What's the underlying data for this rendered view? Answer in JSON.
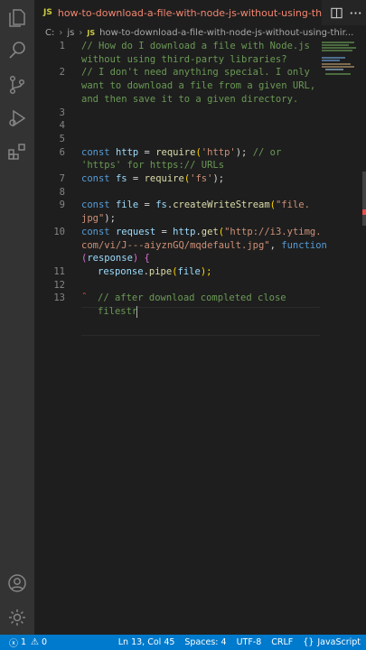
{
  "tab": {
    "language_badge": "JS",
    "title": "how-to-download-a-file-with-node-js-without-using-third-party-l"
  },
  "breadcrumb": {
    "drive": "C:",
    "folder": "js",
    "language_badge": "JS",
    "file": "how-to-download-a-file-with-node-js-without-using-thir..."
  },
  "editor": {
    "line_numbers": [
      "1",
      "2",
      "3",
      "4",
      "5",
      "6",
      "7",
      "8",
      "9",
      "10",
      "11",
      "12",
      "13"
    ],
    "code": {
      "l1a": "// How do I download a file with Node.js",
      "l1b": "without using third-party libraries?",
      "l2a": "// I don't need anything special. I only",
      "l2b": "want to download a file from a given URL,",
      "l2c": "and then save it to a given directory.",
      "l6_const": "const",
      "l6_http": "http",
      "l6_eq": " = ",
      "l6_require": "require",
      "l6_open": "(",
      "l6_str": "'http'",
      "l6_close": ");",
      "l6_comment": " // or",
      "l6_comment2": "'https' for https:// URLs",
      "l7_const": "const",
      "l7_fs": "fs",
      "l7_eq": " = ",
      "l7_require": "require",
      "l7_open": "(",
      "l7_str": "'fs'",
      "l7_close": ");",
      "l9_const": "const",
      "l9_file": "file",
      "l9_eq": " = ",
      "l9_fs": "fs",
      "l9_dot": ".",
      "l9_fn": "createWriteStream",
      "l9_open": "(",
      "l9_str1": "\"file.",
      "l9_str2": "jpg\"",
      "l9_close": ");",
      "l10_const": "const",
      "l10_request": "request",
      "l10_eq": " = ",
      "l10_http": "http",
      "l10_dot": ".",
      "l10_get": "get",
      "l10_open": "(",
      "l10_str1": "\"http://i3.ytimg.",
      "l10_str2": "com/vi/J---aiyznGQ/mqdefault.jpg\"",
      "l10_comma": ", ",
      "l10_function": "function",
      "l10_popen": "(",
      "l10_response": "response",
      "l10_pclose": ")",
      "l10_brace": " {",
      "l11_response": "response",
      "l11_dot": ".",
      "l11_pipe": "pipe",
      "l11_open": "(",
      "l11_file": "file",
      "l11_close": ");",
      "l13a": "// after download completed close",
      "l13b": "filestr"
    }
  },
  "statusbar": {
    "errors": "1",
    "warnings": "0",
    "position": "Ln 13, Col 45",
    "spaces": "Spaces: 4",
    "encoding": "UTF-8",
    "eol": "CRLF",
    "language": "JavaScript"
  },
  "colors": {
    "accent": "#007acc",
    "tab_title": "#f48771",
    "comment": "#6a9955",
    "keyword": "#569cd6",
    "string": "#ce9178"
  }
}
